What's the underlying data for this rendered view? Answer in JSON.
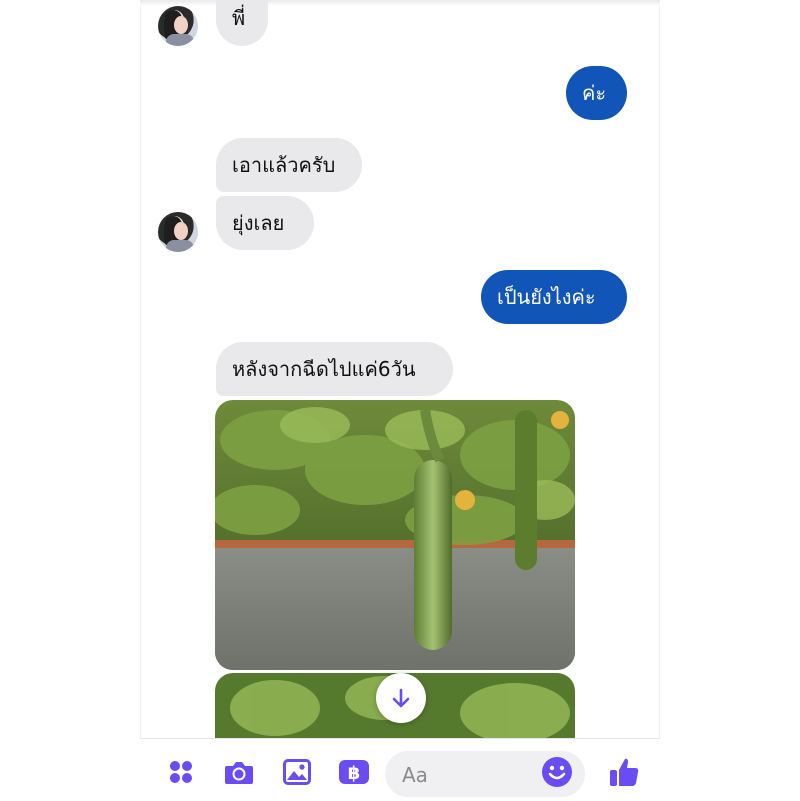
{
  "messages": [
    {
      "text": "พี่",
      "side": "in"
    },
    {
      "text": "ค่ะ",
      "side": "out"
    },
    {
      "text": "เอาแล้วครับ",
      "side": "in"
    },
    {
      "text": "ยุ่งเลย",
      "side": "in"
    },
    {
      "text": "เป็นยังไงค่ะ",
      "side": "out"
    },
    {
      "text": "หลังจากฉีดไปแค่6วัน",
      "side": "in"
    }
  ],
  "composer": {
    "placeholder": "Aa",
    "icons": [
      "apps-icon",
      "camera-icon",
      "image-icon",
      "baht-icon",
      "emoji-icon",
      "like-icon"
    ]
  },
  "colors": {
    "accent": "#1155b8",
    "icon": "#6a4cf3",
    "incoming_bubble": "#e9e9eb"
  }
}
